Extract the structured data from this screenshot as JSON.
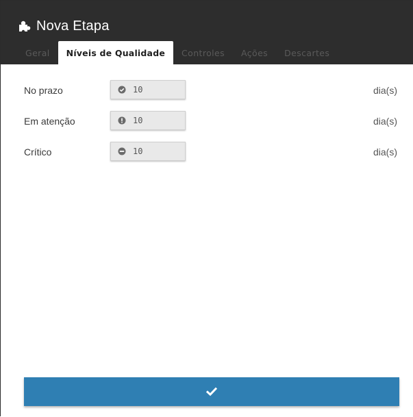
{
  "dialog": {
    "title": "Nova Etapa",
    "title_icon": "puzzle-piece-icon"
  },
  "tabs": [
    {
      "label": "Geral",
      "active": false
    },
    {
      "label": "Níveis de Qualidade",
      "active": true
    },
    {
      "label": "Controles",
      "active": false
    },
    {
      "label": "Ações",
      "active": false
    },
    {
      "label": "Descartes",
      "active": false
    }
  ],
  "levels": [
    {
      "label": "No prazo",
      "value": "10",
      "unit": "dia(s)",
      "icon": "check-circle-icon"
    },
    {
      "label": "Em atenção",
      "value": "10",
      "unit": "dia(s)",
      "icon": "exclamation-circle-icon"
    },
    {
      "label": "Crítico",
      "value": "10",
      "unit": "dia(s)",
      "icon": "minus-circle-icon"
    }
  ],
  "confirm_button": {
    "icon": "checkmark-icon"
  },
  "colors": {
    "header": "#2d2d2d",
    "accent": "#2f7fb3"
  }
}
